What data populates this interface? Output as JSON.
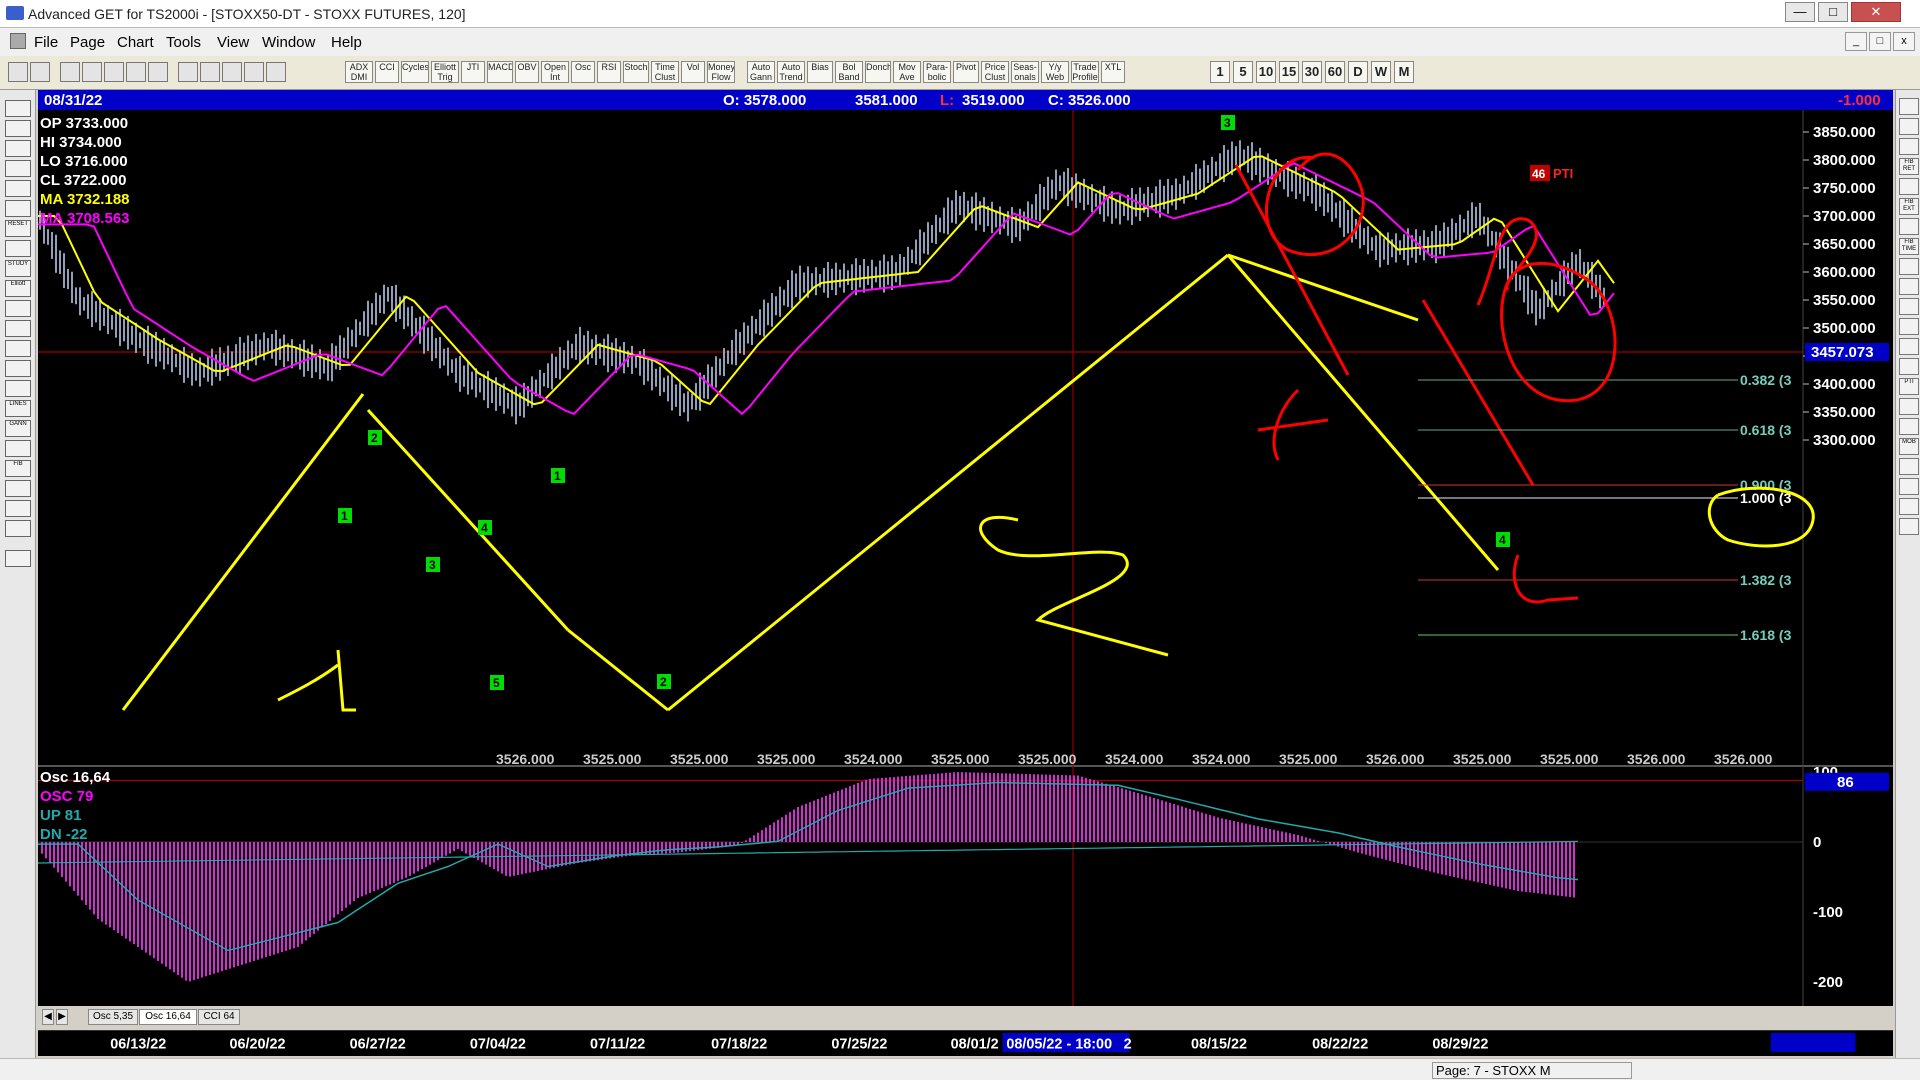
{
  "window": {
    "title": "Advanced GET for TS2000i - [STOXX50-DT - STOXX FUTURES, 120]"
  },
  "menu": [
    "File",
    "Page",
    "Chart",
    "Tools",
    "View",
    "Window",
    "Help"
  ],
  "toolbar": {
    "studies": [
      "ADX DMI",
      "CCI",
      "Cycles",
      "Elliott Trig",
      "JTI",
      "MACD",
      "OBV",
      "Open Int",
      "Osc",
      "RSI",
      "Stoch",
      "Time Clust",
      "Vol",
      "Money Flow",
      "Auto Gann",
      "Auto Trend",
      "Bias",
      "Bol Band",
      "Donch",
      "Mov Ave",
      "Para-bolic",
      "Pivot",
      "Price Clust",
      "Seas-onals",
      "Y/y Web",
      "Trade Profile",
      "XTL"
    ],
    "intervals": [
      "1",
      "5",
      "10",
      "15",
      "30",
      "60",
      "D",
      "W",
      "M"
    ]
  },
  "left_tools": [
    "RESET",
    "STUDY",
    "Elliott",
    "LINES",
    "GANN",
    "FIB"
  ],
  "right_tools": [
    "FIB RET",
    "FIB EXT",
    "FIB TIME",
    "PTI",
    "MOB"
  ],
  "infobar": {
    "date": "08/31/22",
    "open": "O: 3578.000",
    "high": "3581.000",
    "low_label": "L:",
    "low": "3519.000",
    "close": "C: 3526.000",
    "change": "-1.000"
  },
  "legend": {
    "op": "OP  3733.000",
    "hi": "HI   3734.000",
    "lo": "LO  3716.000",
    "cl": "CL  3722.000",
    "ma1": "MA  3732.188",
    "ma2": "MA  3708.563"
  },
  "price_axis": {
    "ticks": [
      "3850.000",
      "3800.000",
      "3750.000",
      "3700.000",
      "3650.000",
      "3600.000",
      "3550.000",
      "3500.000",
      "3450.000",
      "3400.000",
      "3350.000",
      "3300.000"
    ],
    "current_price": "3457.073"
  },
  "fib_labels": [
    "0.382 (3",
    "0.618 (3",
    "0.900 (3",
    "1.000 (3",
    "1.382 (3",
    "1.618 (3"
  ],
  "pti": {
    "value": "46",
    "label": "PTI"
  },
  "bottom_row": [
    "3526.000",
    "3525.000",
    "3525.000",
    "3525.000",
    "3524.000",
    "3525.000",
    "3525.000",
    "3524.000",
    "3524.000",
    "3525.000",
    "3526.000",
    "3525.000",
    "3525.000",
    "3526.000",
    "3526.000"
  ],
  "osc_legend": {
    "title": "Osc 16,64",
    "osc": "OSC 79",
    "up": "UP   81",
    "dn": "DN   -22"
  },
  "osc_axis": {
    "ticks": [
      "100",
      "0",
      "-100",
      "-200"
    ],
    "current": "86"
  },
  "bottom_tabs": [
    "Osc 5,35",
    "Osc 16,64",
    "CCI 64"
  ],
  "dates": [
    "06/13/22",
    "06/20/22",
    "06/27/22",
    "07/04/22",
    "07/11/22",
    "07/18/22",
    "07/25/22",
    "08/01/2",
    "08/05/22 - 18:00",
    "2",
    "08/15/22",
    "08/22/22",
    "08/29/22"
  ],
  "status": "Page: 7 - STOXX M",
  "wave_labels": {
    "green_boxes": [
      "2",
      "1",
      "3",
      "4",
      "5",
      "1",
      "2",
      "3",
      "4"
    ],
    "numbers": [
      "1",
      "2"
    ]
  },
  "colors": {
    "yellow": "#ffff00",
    "magenta": "#ff00ff",
    "green": "#00ff00",
    "red": "#ff0000",
    "blue_bar": "#0000c8"
  }
}
